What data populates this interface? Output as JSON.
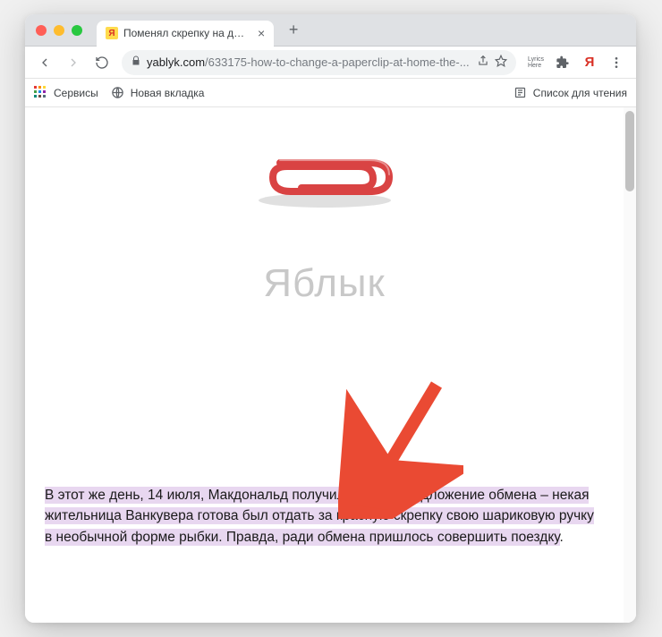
{
  "tab": {
    "title": "Поменял скрепку на дом: ре",
    "favicon_letter": "Я"
  },
  "url": {
    "domain": "yablyk.com",
    "path": "/633175-how-to-change-a-paperclip-at-home-the-..."
  },
  "bookmarks": {
    "services": "Сервисы",
    "newpage": "Новая вкладка",
    "readinglist": "Список для чтения"
  },
  "watermark": "Яблык",
  "article": {
    "highlighted": "В этот же день, 14 июля, Макдональд получил первое предложение обмена – некая жительница Ванкувера готова был отдать за красную скрепку свою шариковую ручку в необычной форме рыбки. Правда, ради обмена пришлось совершить поездку",
    "tail": "."
  },
  "ext_label": "Lyrics\nHere"
}
